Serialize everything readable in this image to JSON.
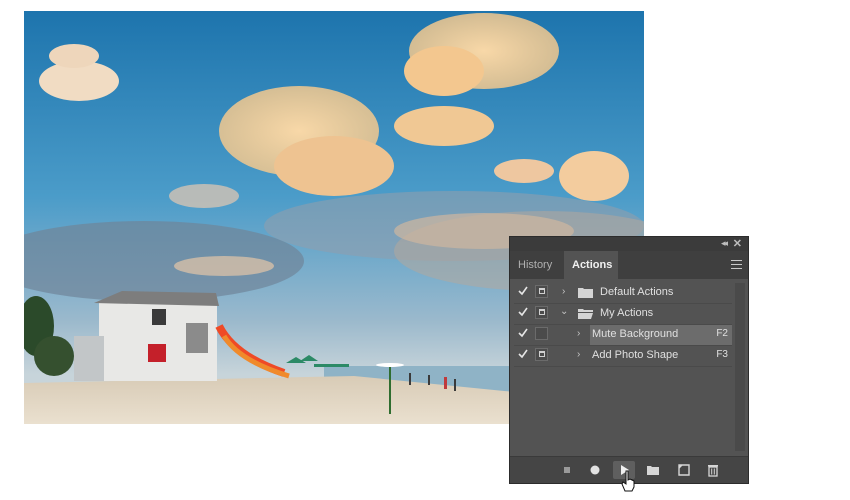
{
  "photo": {
    "description_icon": "beach-photo"
  },
  "panel": {
    "tabs": [
      {
        "label": "History",
        "active": false
      },
      {
        "label": "Actions",
        "active": true
      }
    ],
    "rows": [
      {
        "label": "Default Actions",
        "key": "",
        "checked": true,
        "toggle": true,
        "expanded": false,
        "is_set": true,
        "selected": false
      },
      {
        "label": "My Actions",
        "key": "",
        "checked": true,
        "toggle": true,
        "expanded": true,
        "is_set": true,
        "selected": false
      },
      {
        "label": "Mute Background",
        "key": "F2",
        "checked": true,
        "toggle": false,
        "expanded": false,
        "is_set": false,
        "selected": true
      },
      {
        "label": "Add Photo Shape",
        "key": "F3",
        "checked": true,
        "toggle": true,
        "expanded": false,
        "is_set": false,
        "selected": false
      }
    ],
    "bottom_buttons": [
      "stop-icon",
      "record-icon",
      "play-icon",
      "folder-icon",
      "new-action-icon",
      "trash-icon"
    ]
  },
  "colors": {
    "panel_bg": "#535353",
    "selected_row": "#6c6c6c",
    "sky": "#2f7fb5",
    "sand": "#e3d6c1"
  }
}
